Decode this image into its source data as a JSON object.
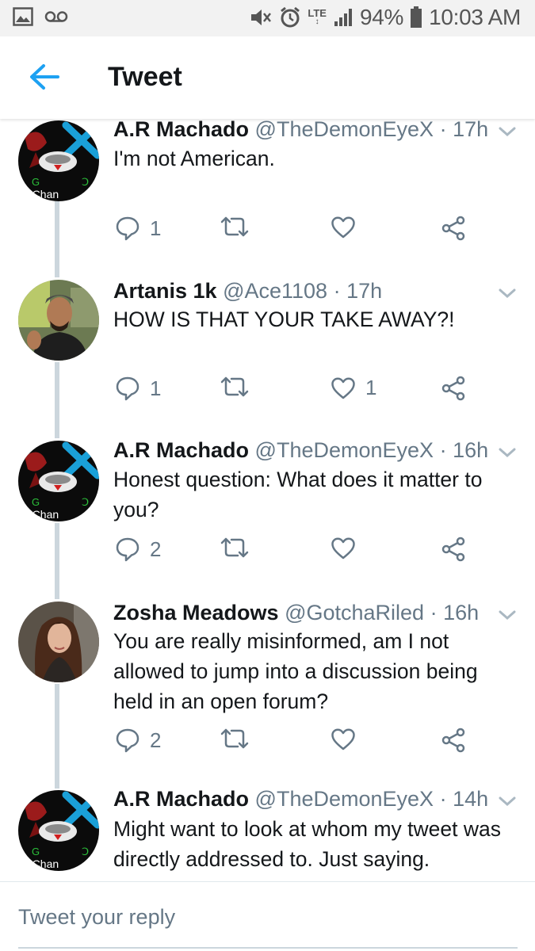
{
  "status_bar": {
    "network": "LTE",
    "battery": "94%",
    "time": "10:03 AM",
    "icons": [
      "image-icon",
      "voicemail-icon",
      "mute-icon",
      "alarm-icon",
      "signal-icon",
      "battery-icon"
    ]
  },
  "header": {
    "title": "Tweet",
    "back_icon": "back-arrow-icon",
    "accent_color": "#1da1f2"
  },
  "tweets": [
    {
      "name": "A.R Machado",
      "handle": "@TheDemonEyeX",
      "sep": "·",
      "time": "17h",
      "text": "I'm not American.",
      "replies": "1",
      "retweets": "",
      "likes": "",
      "avatar": "demoneye-avatar"
    },
    {
      "name": "Artanis 1k",
      "handle": "@Ace1108",
      "sep": "·",
      "time": "17h",
      "text": "HOW IS THAT YOUR TAKE AWAY?!",
      "replies": "1",
      "retweets": "",
      "likes": "1",
      "avatar": "photo-avatar"
    },
    {
      "name": "A.R Machado",
      "handle": "@TheDemonEyeX",
      "sep": "·",
      "time": "16h",
      "text": "Honest question: What does it matter to you?",
      "replies": "2",
      "retweets": "",
      "likes": "",
      "avatar": "demoneye-avatar"
    },
    {
      "name": "Zosha Meadows",
      "handle": "@GotchaRiled",
      "sep": "·",
      "time": "16h",
      "text": "You are really misinformed, am I not allowed to jump into a discussion being held in an open forum?",
      "replies": "2",
      "retweets": "",
      "likes": "",
      "avatar": "photo-avatar"
    },
    {
      "name": "A.R Machado",
      "handle": "@TheDemonEyeX",
      "sep": "·",
      "time": "14h",
      "text": "Might want to look at whom my tweet was directly addressed to. Just saying.",
      "replies": "",
      "retweets": "",
      "likes": "",
      "avatar": "demoneye-avatar"
    }
  ],
  "avatar_labels": {
    "demoneye": {
      "left": "G",
      "right": "Ↄ",
      "bottom": "e Chan"
    }
  },
  "reply": {
    "placeholder": "Tweet your reply"
  },
  "colors": {
    "text_primary": "#14171a",
    "text_secondary": "#657786",
    "thread_line": "#ccd6dd",
    "status_bar_bg": "#f2f2f2"
  }
}
